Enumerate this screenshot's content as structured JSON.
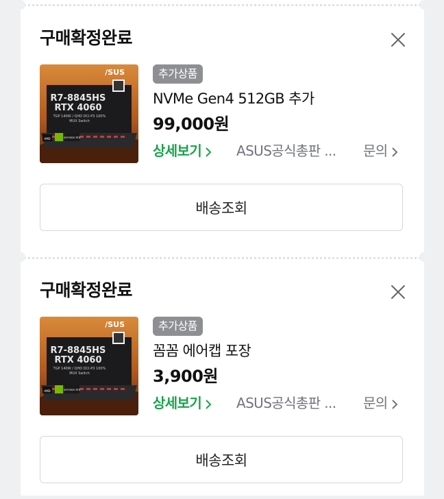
{
  "colors": {
    "page_bg": "#eef0f2",
    "card_bg": "#ffffff",
    "accent_green": "#17a34a",
    "badge_gray": "#8d8f93",
    "muted_text": "#70747a"
  },
  "orders": [
    {
      "status": "구매확정완료",
      "badge": "추가상품",
      "product_name": "NVMe Gen4 512GB 추가",
      "price": "99,000원",
      "detail_link": "상세보기",
      "seller": "ASUS공식총판 ...",
      "inquiry": "문의",
      "track_button": "배송조회",
      "thumbnail": {
        "brand": "/SUS",
        "line1": "R7-8845HS",
        "line2": "RTX 4060",
        "spec1": "TGP 140W / QHD DCI-P3 100%",
        "spec2": "MUX Switch",
        "chip1": "AMD",
        "chip2": "GEFORCE RTX"
      }
    },
    {
      "status": "구매확정완료",
      "badge": "추가상품",
      "product_name": "꼼꼼 에어캡 포장",
      "price": "3,900원",
      "detail_link": "상세보기",
      "seller": "ASUS공식총판 ...",
      "inquiry": "문의",
      "track_button": "배송조회",
      "thumbnail": {
        "brand": "/SUS",
        "line1": "R7-8845HS",
        "line2": "RTX 4060",
        "spec1": "TGP 140W / QHD DCI-P3 100%",
        "spec2": "MUX Switch",
        "chip1": "AMD",
        "chip2": "GEFORCE RTX"
      }
    }
  ],
  "icons": {
    "close": "close-icon",
    "chevron": "chevron-right-icon"
  }
}
